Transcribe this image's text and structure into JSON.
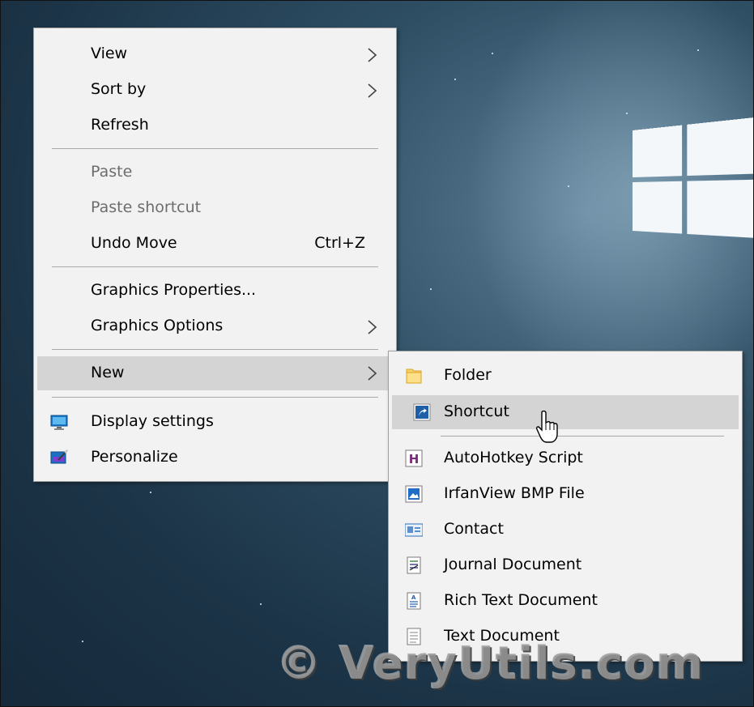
{
  "desktop": {
    "main_menu": {
      "view": "View",
      "sort_by": "Sort by",
      "refresh": "Refresh",
      "paste": "Paste",
      "paste_shortcut": "Paste shortcut",
      "undo_move": "Undo Move",
      "undo_move_shortcut": "Ctrl+Z",
      "graphics_properties": "Graphics Properties...",
      "graphics_options": "Graphics Options",
      "new": "New",
      "display_settings": "Display settings",
      "personalize": "Personalize"
    },
    "new_submenu": {
      "folder": "Folder",
      "shortcut": "Shortcut",
      "autohotkey": "AutoHotkey Script",
      "irfanview": "IrfanView BMP File",
      "contact": "Contact",
      "journal": "Journal Document",
      "rtf": "Rich Text Document",
      "txt": "Text Document"
    },
    "watermark": "© VeryUtils.com",
    "colors": {
      "menu_bg": "#f2f2f2",
      "highlight": "#d4d4d4",
      "disabled_text": "#6d6d6d",
      "desktop_bg": "#1c3447"
    },
    "icons": [
      "chevron-right-icon",
      "folder-icon",
      "shortcut-icon",
      "autohotkey-icon",
      "irfanview-icon",
      "contact-icon",
      "journal-icon",
      "rich-text-icon",
      "text-document-icon",
      "display-settings-icon",
      "personalize-icon",
      "mouse-cursor-icon",
      "windows-logo"
    ]
  }
}
